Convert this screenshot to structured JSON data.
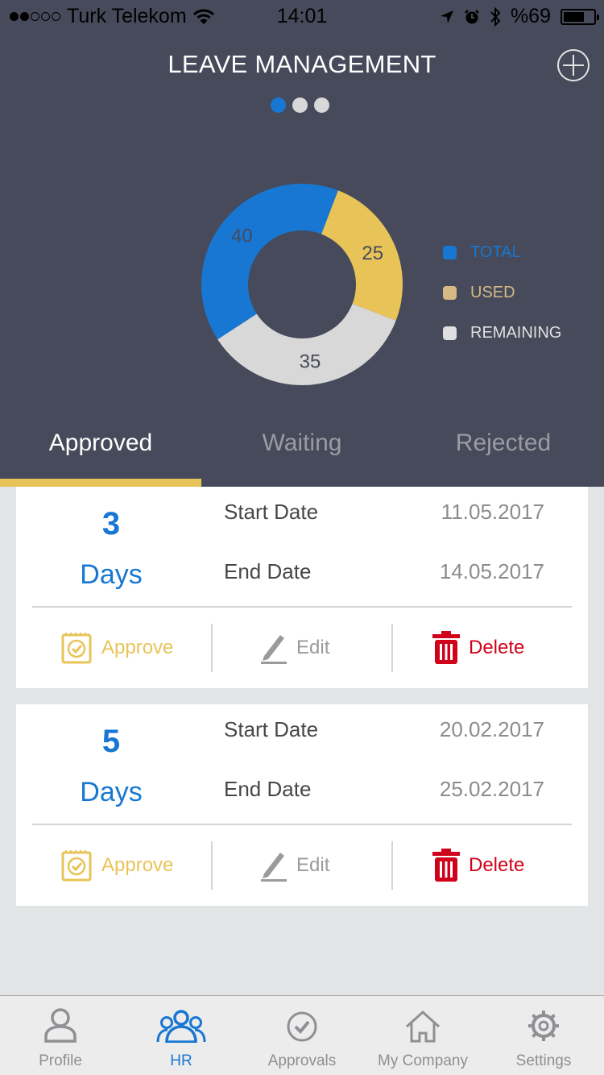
{
  "status_bar": {
    "carrier": "Turk Telekom",
    "signal_bars_filled": 2,
    "signal_bars_total": 5,
    "time": "14:01",
    "battery_text": "%69",
    "battery_level": 0.69
  },
  "header": {
    "title": "LEAVE MANAGEMENT",
    "add_icon": "plus-circle-icon",
    "pager": {
      "pages": 3,
      "active_index": 0
    }
  },
  "chart_data": {
    "type": "pie",
    "variant": "donut",
    "title": "",
    "slices": [
      {
        "label": "TOTAL",
        "value": 40,
        "color": "#1877d2"
      },
      {
        "label": "USED",
        "value": 25,
        "color": "#e8c458"
      },
      {
        "label": "REMAINING",
        "value": 35,
        "color": "#d8d8d8"
      }
    ],
    "legend": {
      "placement": "right",
      "entries": [
        {
          "label": "TOTAL",
          "color": "#1877d2",
          "text_color": "#1877d2"
        },
        {
          "label": "USED",
          "color": "#d6b985",
          "text_color": "#d6b985"
        },
        {
          "label": "REMAINING",
          "color": "#e0e0e0",
          "text_color": "#e0e0e0"
        }
      ]
    }
  },
  "tabs": [
    {
      "label": "Approved",
      "active": true
    },
    {
      "label": "Waiting",
      "active": false
    },
    {
      "label": "Rejected",
      "active": false
    }
  ],
  "leaves": [
    {
      "days": "3",
      "days_label": "Days",
      "start_label": "Start Date",
      "start_date": "11.05.2017",
      "end_label": "End Date",
      "end_date": "14.05.2017",
      "actions": {
        "approve": "Approve",
        "edit": "Edit",
        "delete": "Delete"
      }
    },
    {
      "days": "5",
      "days_label": "Days",
      "start_label": "Start Date",
      "start_date": "20.02.2017",
      "end_label": "End Date",
      "end_date": "25.02.2017",
      "actions": {
        "approve": "Approve",
        "edit": "Edit",
        "delete": "Delete"
      }
    }
  ],
  "tabbar": [
    {
      "label": "Profile",
      "icon": "person-icon",
      "active": false
    },
    {
      "label": "HR",
      "icon": "group-icon",
      "active": true
    },
    {
      "label": "Approvals",
      "icon": "check-circle-icon",
      "active": false
    },
    {
      "label": "My Company",
      "icon": "house-icon",
      "active": false
    },
    {
      "label": "Settings",
      "icon": "gear-icon",
      "active": false
    }
  ],
  "colors": {
    "header_bg": "#464a5a",
    "accent_blue": "#1877d2",
    "accent_yellow": "#e8c458",
    "delete_red": "#d0021b",
    "page_bg": "#e3e4e6"
  }
}
